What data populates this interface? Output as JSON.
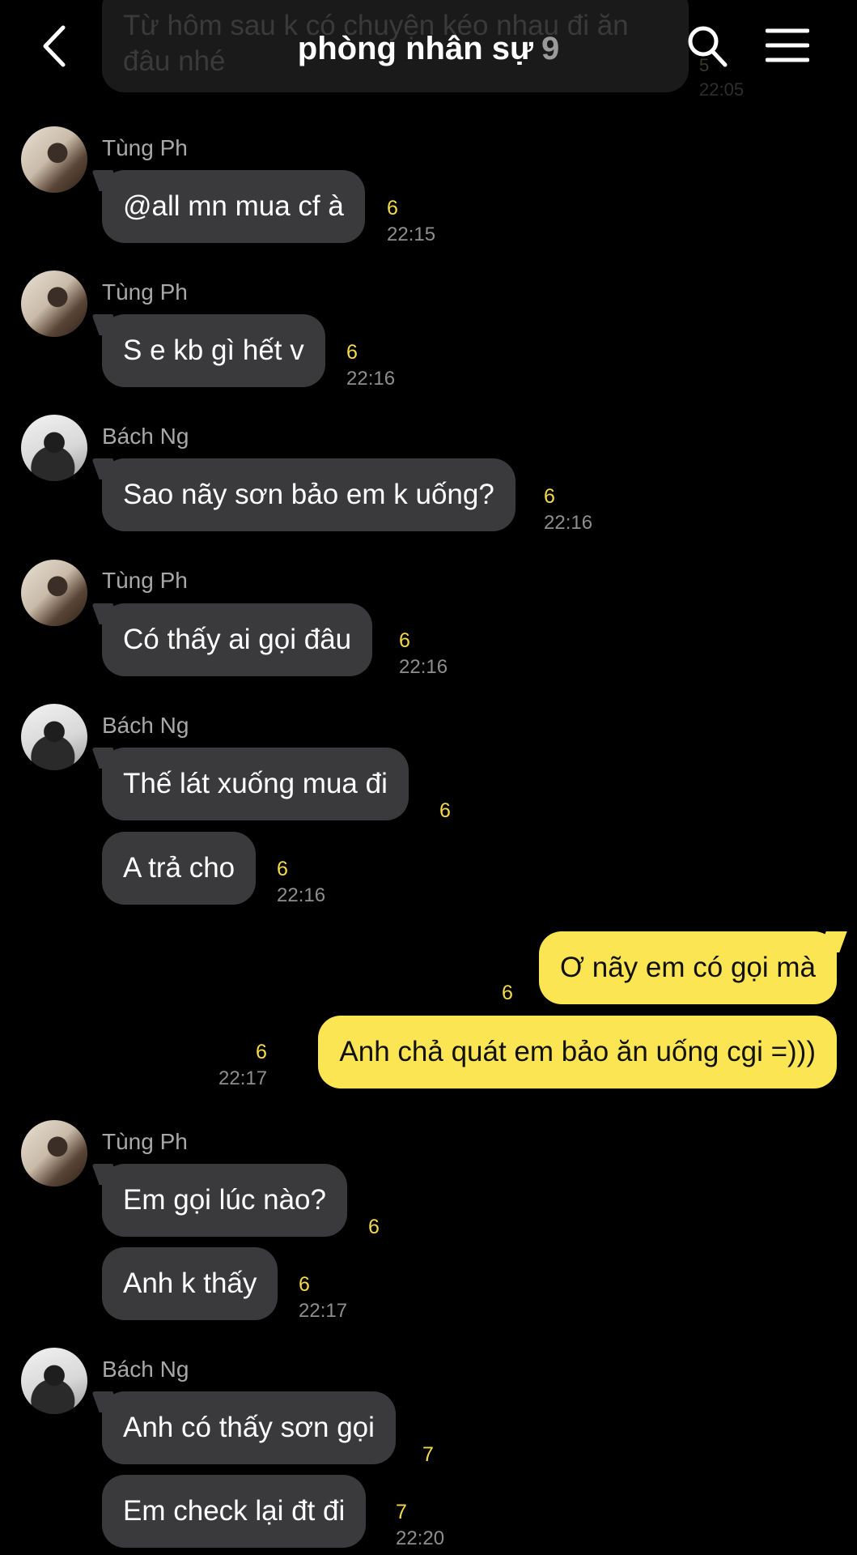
{
  "header": {
    "title": "phòng nhân sự",
    "member_count": "9"
  },
  "previous_message": {
    "text": "Từ hôm sau k có chuyện kéo nhau đi ăn đâu nhé",
    "count": "5",
    "time": "22:05"
  },
  "messages": [
    {
      "sender": "Tùng Ph",
      "text": "@all mn mua cf à",
      "count": "6",
      "time": "22:15"
    },
    {
      "sender": "Tùng Ph",
      "text": "S e kb gì hết v",
      "count": "6",
      "time": "22:16"
    },
    {
      "sender": "Bách Ng",
      "text": "Sao nãy sơn bảo em k uống?",
      "count": "6",
      "time": "22:16"
    },
    {
      "sender": "Tùng Ph",
      "text": "Có thấy ai gọi đâu",
      "count": "6",
      "time": "22:16"
    },
    {
      "sender": "Bách Ng",
      "text": "Thế lát xuống mua đi",
      "count": "6"
    },
    {
      "text": "A trả cho",
      "count": "6",
      "time": "22:16"
    },
    {
      "text": "Ơ nãy em có gọi mà",
      "count": "6",
      "mine": true
    },
    {
      "text": "Anh chả quát em bảo ăn uống cgi =)))",
      "count": "6",
      "time": "22:17",
      "mine": true
    },
    {
      "sender": "Tùng Ph",
      "text": "Em gọi lúc nào?",
      "count": "6"
    },
    {
      "text": "Anh k thấy",
      "count": "6",
      "time": "22:17"
    },
    {
      "sender": "Bách Ng",
      "text": "Anh có thấy sơn gọi",
      "count": "7"
    },
    {
      "text": "Em check lại đt đi",
      "count": "7",
      "time": "22:20"
    }
  ]
}
